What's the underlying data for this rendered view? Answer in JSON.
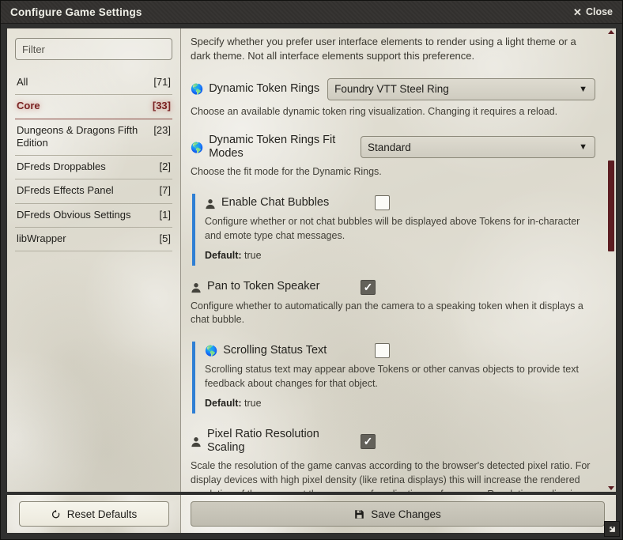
{
  "window": {
    "title": "Configure Game Settings",
    "close_label": "Close",
    "close_icon": "close-x-icon",
    "resize_icon": "resize-handle-icon"
  },
  "sidebar": {
    "filter": {
      "placeholder": "Filter",
      "value": ""
    },
    "categories": [
      {
        "label": "All",
        "count": "[71]",
        "active": false
      },
      {
        "label": "Core",
        "count": "[33]",
        "active": true
      },
      {
        "label": "Dungeons & Dragons Fifth Edition",
        "count": "[23]",
        "active": false
      },
      {
        "label": "DFreds Droppables",
        "count": "[2]",
        "active": false
      },
      {
        "label": "DFreds Effects Panel",
        "count": "[7]",
        "active": false
      },
      {
        "label": "DFreds Obvious Settings",
        "count": "[1]",
        "active": false
      },
      {
        "label": "libWrapper",
        "count": "[5]",
        "active": false
      }
    ]
  },
  "main": {
    "intro_paragraph": "Specify whether you prefer user interface elements to render using a light theme or a dark theme. Not all interface elements support this preference.",
    "settings": [
      {
        "id": "dynamic-token-rings",
        "scope_icon": "globe-icon",
        "label": "Dynamic Token Rings",
        "control": "select",
        "value": "Foundry VTT Steel Ring",
        "options": [
          "Foundry VTT Steel Ring"
        ],
        "hint": "Choose an available dynamic token ring visualization. Changing it requires a reload.",
        "modified": false
      },
      {
        "id": "dynamic-token-rings-fit-modes",
        "scope_icon": "globe-icon",
        "label": "Dynamic Token Rings Fit Modes",
        "control": "select",
        "value": "Standard",
        "options": [
          "Standard"
        ],
        "hint": "Choose the fit mode for the Dynamic Rings.",
        "modified": false
      },
      {
        "id": "enable-chat-bubbles",
        "scope_icon": "user-icon",
        "label": "Enable Chat Bubbles",
        "control": "checkbox",
        "checked": false,
        "hint": "Configure whether or not chat bubbles will be displayed above Tokens for in-character and emote type chat messages.",
        "default_label": "Default:",
        "default_value": "true",
        "modified": true
      },
      {
        "id": "pan-to-token-speaker",
        "scope_icon": "user-icon",
        "label": "Pan to Token Speaker",
        "control": "checkbox",
        "checked": true,
        "hint": "Configure whether to automatically pan the camera to a speaking token when it displays a chat bubble.",
        "modified": false
      },
      {
        "id": "scrolling-status-text",
        "scope_icon": "globe-icon",
        "label": "Scrolling Status Text",
        "control": "checkbox",
        "checked": false,
        "hint": "Scrolling status text may appear above Tokens or other canvas objects to provide text feedback about changes for that object.",
        "default_label": "Default:",
        "default_value": "true",
        "modified": true
      },
      {
        "id": "pixel-ratio-resolution-scaling",
        "scope_icon": "user-icon",
        "label": "Pixel Ratio Resolution Scaling",
        "control": "checkbox",
        "checked": true,
        "hint": "Scale the resolution of the game canvas according to the browser's detected pixel ratio. For display devices with high pixel density (like retina displays) this will increase the rendered resolution of the canvas at the expense of application performance. Resolution scaling is also impacted by the zoom level of the browser or operating system display settings. In such cases this setting will increase or decrease the effective resolution of the canvas depending on the amount of zoom that is applied.",
        "modified": false
      }
    ]
  },
  "footer": {
    "reset_label": "Reset Defaults",
    "reset_icon": "undo-icon",
    "save_label": "Save Changes",
    "save_icon": "save-floppy-icon"
  },
  "colors": {
    "accent_maroon": "#7a2222",
    "modified_blue": "#2f7fd4",
    "scrollbar_thumb": "#5c1d22",
    "titlebar": "#33312f",
    "parchment": "#dedbd0"
  }
}
